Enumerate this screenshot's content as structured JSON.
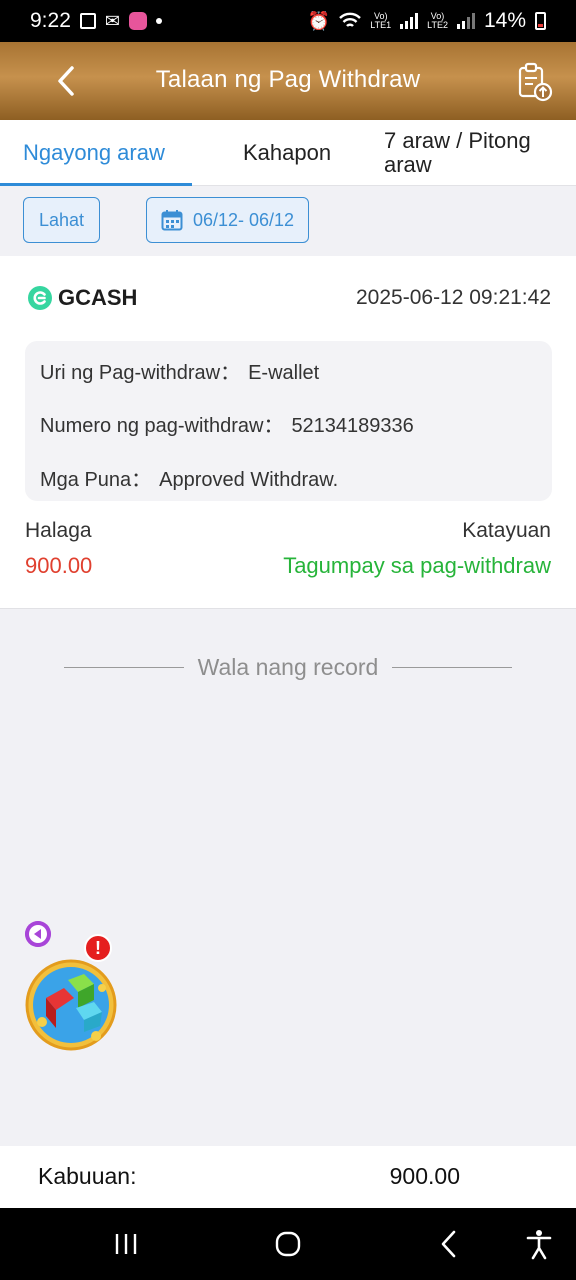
{
  "status_bar": {
    "time": "9:22",
    "sim1_label": "Vo)\nLTE1",
    "sim2_label": "Vo)\nLTE2",
    "battery": "14%"
  },
  "header": {
    "title": "Talaan ng Pag Withdraw",
    "back_icon": "chevron-left-icon",
    "export_icon": "clipboard-upload-icon"
  },
  "tabs": [
    {
      "label": "Ngayong araw",
      "active": true
    },
    {
      "label": "Kahapon",
      "active": false
    },
    {
      "label": "7 araw / Pitong araw",
      "active": false
    }
  ],
  "filters": {
    "type_label": "Lahat",
    "date_range": "06/12- 06/12"
  },
  "records": [
    {
      "method": "GCASH",
      "datetime": "2025-06-12 09:21:42",
      "type_label": "Uri ng Pag-withdraw：",
      "type_value": "E-wallet",
      "number_label": "Numero ng pag-withdraw：",
      "number_value": "52134189336",
      "remarks_label": "Mga Puna：",
      "remarks_value": "Approved Withdraw.",
      "amount_label": "Halaga",
      "amount_value": "900.00",
      "status_label": "Katayuan",
      "status_value": "Tagumpay sa pag-withdraw"
    }
  ],
  "no_more_text": "Wala nang record",
  "floating": {
    "alert": "!"
  },
  "footer": {
    "total_label": "Kabuuan:",
    "total_value": "900.00"
  },
  "colors": {
    "accent": "#2e8bd8",
    "header_gold": "#b07a38",
    "amount_red": "#e0402f",
    "status_green": "#27b43a"
  }
}
